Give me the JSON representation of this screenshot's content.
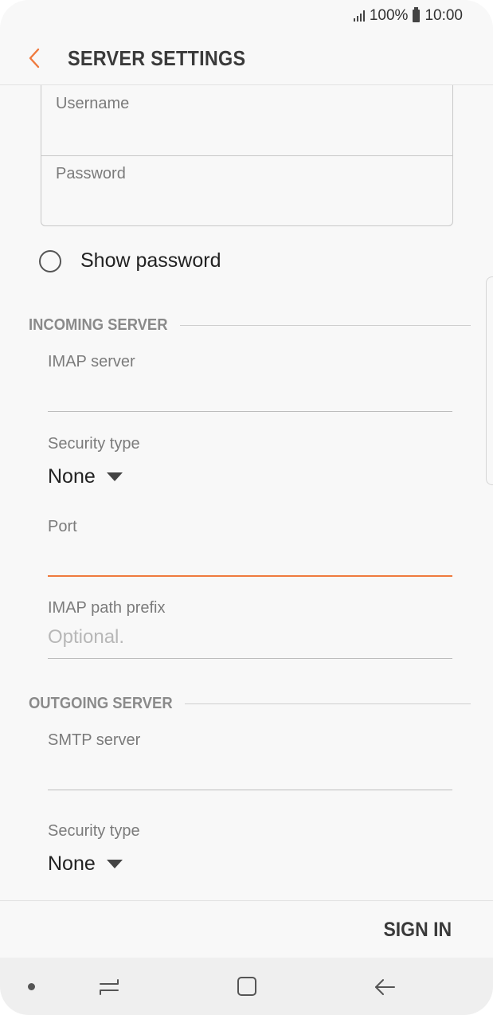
{
  "status_bar": {
    "battery_text": "100%",
    "time": "10:00"
  },
  "header": {
    "title": "SERVER SETTINGS"
  },
  "credentials": {
    "username_label": "Username",
    "password_label": "Password"
  },
  "show_password": {
    "label": "Show password",
    "checked": false
  },
  "incoming": {
    "section_title": "INCOMING SERVER",
    "server_label": "IMAP server",
    "security_label": "Security type",
    "security_value": "None",
    "port_label": "Port",
    "path_prefix_label": "IMAP path prefix",
    "path_prefix_placeholder": "Optional."
  },
  "outgoing": {
    "section_title": "OUTGOING SERVER",
    "server_label": "SMTP server",
    "security_label": "Security type",
    "security_value": "None"
  },
  "footer": {
    "sign_in_label": "SIGN IN"
  },
  "colors": {
    "accent": "#ef7a3e",
    "text_primary": "#222222",
    "text_secondary": "#7b7b7b"
  },
  "icons": {
    "back": "chevron-left-icon",
    "signal": "signal-icon",
    "battery": "battery-icon",
    "radio": "radio-unchecked-icon",
    "caret": "caret-down-icon",
    "nav_recent": "recent-apps-icon",
    "nav_home": "home-icon",
    "nav_back": "back-arrow-icon"
  }
}
